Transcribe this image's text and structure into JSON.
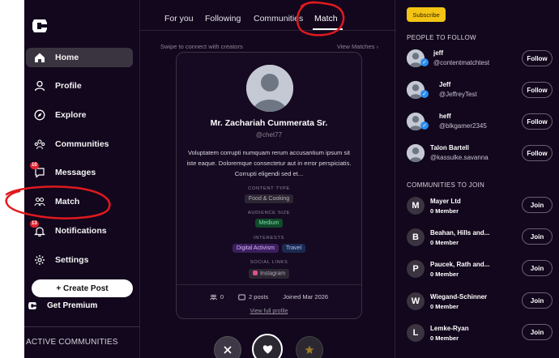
{
  "nav": {
    "items": [
      {
        "label": "Home",
        "icon": "home-icon"
      },
      {
        "label": "Profile",
        "icon": "user-icon"
      },
      {
        "label": "Explore",
        "icon": "compass-icon"
      },
      {
        "label": "Communities",
        "icon": "people-icon"
      },
      {
        "label": "Messages",
        "icon": "message-icon",
        "badge": "10"
      },
      {
        "label": "Match",
        "icon": "match-icon"
      },
      {
        "label": "Notifications",
        "icon": "bell-icon",
        "badge": "13"
      },
      {
        "label": "Settings",
        "icon": "gear-icon"
      }
    ],
    "create_post": "+ Create Post",
    "premium": "Get Premium",
    "active_communities": "ACTIVE COMMUNITIES"
  },
  "tabs": [
    "For you",
    "Following",
    "Communities",
    "Match"
  ],
  "match": {
    "swipe_hint": "Swipe to connect with creators",
    "view_matches": "View Matches",
    "view_matches_chevron": "›",
    "name": "Mr. Zachariah Cummerata Sr.",
    "handle": "@chet77",
    "bio": "Voluptatem corrupti numquam rerum accusantium ipsum sit iste eaque. Doloremque consectetur aut in error perspiciatis. Corrupti eligendi sed et...",
    "content_type_label": "CONTENT TYPE",
    "content_type": "Food & Cooking",
    "audience_label": "AUDIENCE SIZE",
    "audience": "Medium",
    "interests_label": "INTERESTS",
    "interests": [
      "Digital Activism",
      "Travel"
    ],
    "social_label": "SOCIAL LINKS",
    "social": "Instagram",
    "followers": "0",
    "posts": "2 posts",
    "joined": "Joined Mar 2026",
    "view_full": "View full profile"
  },
  "right": {
    "subscribe": "Subscribe",
    "people_header": "PEOPLE TO FOLLOW",
    "follow_label": "Follow",
    "people": [
      {
        "name": "jeff",
        "handle": "@contentmatchtest",
        "verified": true
      },
      {
        "name": "Jeff",
        "handle": "@JeffreyTest",
        "verified": true
      },
      {
        "name": "heff",
        "handle": "@blkgamer2345",
        "verified": true
      },
      {
        "name": "Talon Bartell",
        "handle": "@kassulke.savanna",
        "verified": false
      }
    ],
    "communities_header": "COMMUNITIES TO JOIN",
    "join_label": "Join",
    "communities": [
      {
        "initial": "M",
        "name": "Mayer Ltd",
        "members": "0 Member"
      },
      {
        "initial": "B",
        "name": "Beahan, Hills and...",
        "members": "0 Member"
      },
      {
        "initial": "P",
        "name": "Paucek, Rath and...",
        "members": "0 Member"
      },
      {
        "initial": "W",
        "name": "Wiegand-Schinner",
        "members": "0 Member"
      },
      {
        "initial": "L",
        "name": "Lemke-Ryan",
        "members": "0 Member"
      }
    ]
  },
  "colors": {
    "background": "#12071d",
    "accent": "#f4c414",
    "annotation": "#e0191f"
  }
}
